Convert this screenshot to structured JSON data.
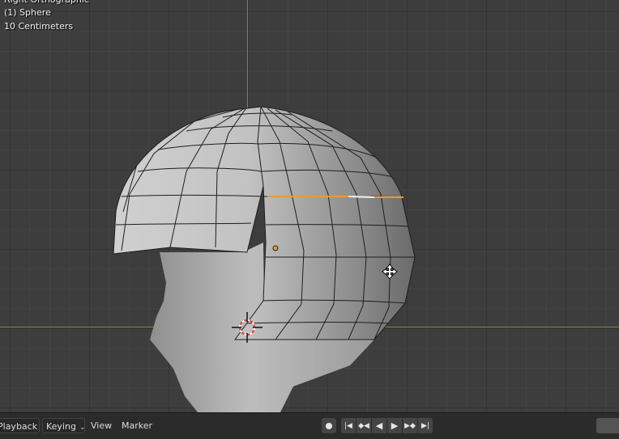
{
  "viewport": {
    "view_name": "Right Orthographic",
    "object_label": "(1) Sphere",
    "scale_label": "10 Centimeters"
  },
  "timeline": {
    "playback_label": "Playback",
    "keying_label": "Keying",
    "view_label": "View",
    "marker_label": "Marker"
  },
  "colors": {
    "grid_background": "#3d3d3d",
    "z_axis": "#4c7fd6",
    "y_axis": "#6f8f3a",
    "selected_edge": "#e69a3c",
    "header_bar": "#2b2b2b"
  }
}
